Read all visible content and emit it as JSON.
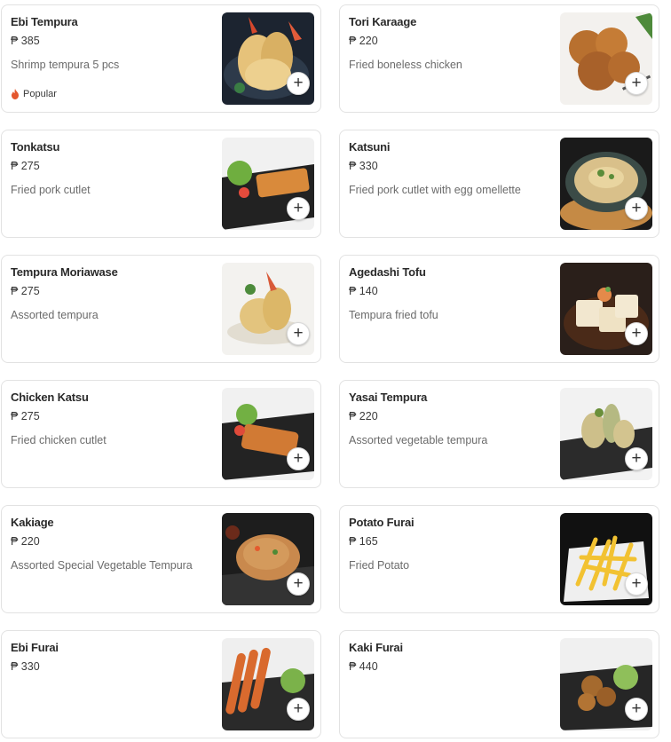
{
  "currency": "₱",
  "items": [
    {
      "name": "Ebi Tempura",
      "price": "₱ 385",
      "desc": "Shrimp tempura 5 pcs",
      "tag": "Popular",
      "photo": "shrimp-tempura"
    },
    {
      "name": "Tori Karaage",
      "price": "₱ 220",
      "desc": "Fried boneless chicken",
      "tag": "",
      "photo": "fried-chicken"
    },
    {
      "name": "Tonkatsu",
      "price": "₱ 275",
      "desc": "Fried pork cutlet",
      "tag": "",
      "photo": "pork-cutlet"
    },
    {
      "name": "Katsuni",
      "price": "₱ 330",
      "desc": "Fried pork cutlet with egg omellette",
      "tag": "",
      "photo": "egg-omelette-pan"
    },
    {
      "name": "Tempura Moriawase",
      "price": "₱ 275",
      "desc": "Assorted tempura",
      "tag": "",
      "photo": "assorted-tempura"
    },
    {
      "name": "Agedashi Tofu",
      "price": "₱ 140",
      "desc": "Tempura fried tofu",
      "tag": "",
      "photo": "fried-tofu"
    },
    {
      "name": "Chicken Katsu",
      "price": "₱ 275",
      "desc": "Fried chicken cutlet",
      "tag": "",
      "photo": "chicken-cutlet"
    },
    {
      "name": "Yasai Tempura",
      "price": "₱ 220",
      "desc": "Assorted vegetable tempura",
      "tag": "",
      "photo": "vegetable-tempura"
    },
    {
      "name": "Kakiage",
      "price": "₱ 220",
      "desc": "Assorted Special Vegetable Tempura",
      "tag": "",
      "photo": "kakiage"
    },
    {
      "name": "Potato Furai",
      "price": "₱ 165",
      "desc": "Fried Potato",
      "tag": "",
      "photo": "french-fries"
    },
    {
      "name": "Ebi Furai",
      "price": "₱ 330",
      "desc": "",
      "tag": "",
      "photo": "fried-shrimp"
    },
    {
      "name": "Kaki Furai",
      "price": "₱ 440",
      "desc": "",
      "tag": "",
      "photo": "fried-oysters"
    }
  ],
  "add_label": "+",
  "colors": {
    "border": "#e2e2e2",
    "popular_flame": "#e4572e",
    "title": "#2a2a2a",
    "desc": "#6b6b6b"
  }
}
